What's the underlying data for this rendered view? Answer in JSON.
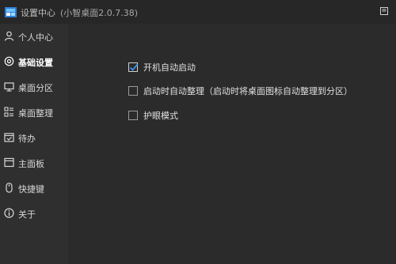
{
  "window": {
    "title": "设置中心",
    "version": "(小智桌面2.0.7.38)"
  },
  "sidebar": {
    "items": [
      {
        "label": "个人中心",
        "icon": "user-icon"
      },
      {
        "label": "基础设置",
        "icon": "settings-gear-icon",
        "active": true
      },
      {
        "label": "桌面分区",
        "icon": "monitor-icon"
      },
      {
        "label": "桌面整理",
        "icon": "grid-organize-icon"
      },
      {
        "label": "待办",
        "icon": "calendar-check-icon"
      },
      {
        "label": "主面板",
        "icon": "panel-icon"
      },
      {
        "label": "快捷键",
        "icon": "mouse-icon"
      },
      {
        "label": "关于",
        "icon": "info-icon"
      }
    ]
  },
  "settings": {
    "options": [
      {
        "label": "开机自动启动",
        "checked": true
      },
      {
        "label": "启动时自动整理（启动时将桌面图标自动整理到分区）",
        "checked": false
      },
      {
        "label": "护眼模式",
        "checked": false
      }
    ]
  },
  "colors": {
    "accent": "#3a8ee6",
    "background": "#2b2b2b",
    "sidebar": "#2f2f2f"
  }
}
